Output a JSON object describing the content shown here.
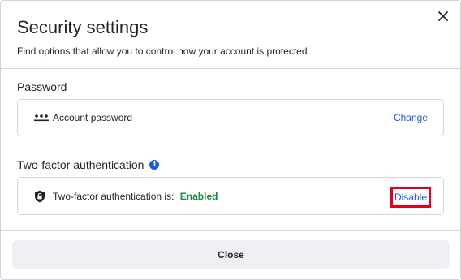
{
  "dialog": {
    "title": "Security settings",
    "subtitle": "Find options that allow you to control how your account is protected.",
    "close_icon": "close-icon"
  },
  "password": {
    "section_label": "Password",
    "icon": "password-dots-icon",
    "label": "Account password",
    "action_label": "Change"
  },
  "two_factor": {
    "section_label": "Two-factor authentication",
    "info_icon": "info-icon",
    "icon": "shield-lock-icon",
    "label": "Two-factor authentication is:",
    "status": "Enabled",
    "action_label": "Disable"
  },
  "footer": {
    "close_label": "Close"
  },
  "colors": {
    "accent": "#1a5bd6",
    "status_enabled": "#1e8a3c",
    "highlight": "#e0001b"
  }
}
